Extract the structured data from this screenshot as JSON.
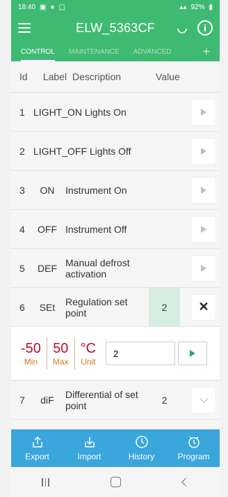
{
  "status": {
    "time": "18:40",
    "battery": "92%"
  },
  "app": {
    "title": "ELW_5363CF"
  },
  "tabs": [
    {
      "label": "CONTROL",
      "active": true
    },
    {
      "label": "MAINTENANCE",
      "active": false
    },
    {
      "label": "ADVANCED",
      "active": false
    }
  ],
  "table": {
    "headers": {
      "id": "Id",
      "label": "Label",
      "description": "Description",
      "value": "Value"
    },
    "rows": [
      {
        "id": "1",
        "combined": "LIGHT_ON Lights On"
      },
      {
        "id": "2",
        "combined": "LIGHT_OFF Lights Off"
      },
      {
        "id": "3",
        "label": "ON",
        "description": "Instrument On",
        "value": ""
      },
      {
        "id": "4",
        "label": "OFF",
        "description": "Instrument Off",
        "value": ""
      },
      {
        "id": "5",
        "label": "DEF",
        "description": "Manual defrost activation",
        "value": ""
      },
      {
        "id": "6",
        "label": "SEt",
        "description": "Regulation set point",
        "value": "2"
      },
      {
        "id": "7",
        "label": "diF",
        "description": "Differential of set point",
        "value": "2"
      }
    ]
  },
  "editor": {
    "min_value": "-50",
    "min_label": "Min",
    "max_value": "50",
    "max_label": "Max",
    "unit_value": "°C",
    "unit_label": "Unit",
    "input_value": "2"
  },
  "bottom_nav": [
    {
      "label": "Export",
      "icon": "export-icon"
    },
    {
      "label": "Import",
      "icon": "import-icon"
    },
    {
      "label": "History",
      "icon": "history-icon"
    },
    {
      "label": "Program",
      "icon": "program-icon"
    }
  ],
  "colors": {
    "primary": "#3fba73",
    "bottom_bar": "#3aa6dc",
    "accent_red": "#b7112a",
    "accent_orange": "#d47b22"
  }
}
